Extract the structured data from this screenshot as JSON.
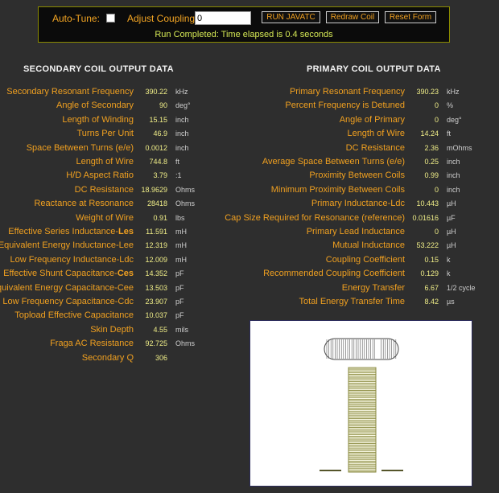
{
  "toolbar": {
    "autotune_label": "Auto-Tune:",
    "coupling_label": "Adjust Coupling:",
    "coupling_value": "0",
    "run_label": "RUN JAVATC",
    "redraw_label": "Redraw Coil",
    "reset_label": "Reset Form",
    "status": "Run Completed: Time elapsed is 0.4 seconds"
  },
  "secondary": {
    "title": "SECONDARY COIL OUTPUT DATA",
    "rows": [
      {
        "label": "Secondary Resonant Frequency",
        "value": "390.22",
        "unit": "kHz"
      },
      {
        "label": "Angle of Secondary",
        "value": "90",
        "unit": "deg°"
      },
      {
        "label": "Length of Winding",
        "value": "15.15",
        "unit": "inch"
      },
      {
        "label": "Turns Per Unit",
        "value": "46.9",
        "unit": "inch"
      },
      {
        "label": "Space Between Turns (e/e)",
        "value": "0.0012",
        "unit": "inch"
      },
      {
        "label": "Length of Wire",
        "value": "744.8",
        "unit": "ft"
      },
      {
        "label": "H/D Aspect Ratio",
        "value": "3.79",
        "unit": ":1"
      },
      {
        "label": "DC Resistance",
        "value": "18.9629",
        "unit": "Ohms"
      },
      {
        "label": "Reactance at Resonance",
        "value": "28418",
        "unit": "Ohms"
      },
      {
        "label": "Weight of Wire",
        "value": "0.91",
        "unit": "lbs"
      },
      {
        "label": "Effective Series Inductance-",
        "bold": "Les",
        "value": "11.591",
        "unit": "mH"
      },
      {
        "label": "Equivalent Energy Inductance-Lee",
        "value": "12.319",
        "unit": "mH"
      },
      {
        "label": "Low Frequency Inductance-Ldc",
        "value": "12.009",
        "unit": "mH"
      },
      {
        "label": "Effective Shunt Capacitance-",
        "bold": "Ces",
        "value": "14.352",
        "unit": "pF"
      },
      {
        "label": "Equivalent Energy Capacitance-Cee",
        "value": "13.503",
        "unit": "pF"
      },
      {
        "label": "Low Frequency Capacitance-Cdc",
        "value": "23.907",
        "unit": "pF"
      },
      {
        "label": "Topload Effective Capacitance",
        "value": "10.037",
        "unit": "pF"
      },
      {
        "label": "Skin Depth",
        "value": "4.55",
        "unit": "mils"
      },
      {
        "label": "Fraga AC Resistance",
        "value": "92.725",
        "unit": "Ohms"
      },
      {
        "label": "Secondary Q",
        "value": "306",
        "unit": ""
      }
    ]
  },
  "primary": {
    "title": "PRIMARY COIL OUTPUT DATA",
    "rows": [
      {
        "label": "Primary Resonant Frequency",
        "value": "390.23",
        "unit": "kHz"
      },
      {
        "label": "Percent Frequency is Detuned",
        "value": "0",
        "unit": "%"
      },
      {
        "label": "Angle of Primary",
        "value": "0",
        "unit": "deg°"
      },
      {
        "label": "Length of Wire",
        "value": "14.24",
        "unit": "ft"
      },
      {
        "label": "DC Resistance",
        "value": "2.36",
        "unit": "mOhms"
      },
      {
        "label": "Average Space Between Turns (e/e)",
        "value": "0.25",
        "unit": "inch"
      },
      {
        "label": "Proximity Between Coils",
        "value": "0.99",
        "unit": "inch"
      },
      {
        "label": "Minimum Proximity Between Coils",
        "value": "0",
        "unit": "inch"
      },
      {
        "label": "Primary Inductance-Ldc",
        "value": "10.443",
        "unit": "µH"
      },
      {
        "label": "Cap Size Required for Resonance (reference)",
        "value": "0.01616",
        "unit": "µF"
      },
      {
        "label": "Primary Lead Inductance",
        "value": "0",
        "unit": "µH"
      },
      {
        "label": "Mutual Inductance",
        "value": "53.222",
        "unit": "µH"
      },
      {
        "label": "Coupling Coefficient",
        "value": "0.15",
        "unit": "k"
      },
      {
        "label": "Recommended Coupling Coefficient",
        "value": "0.129",
        "unit": "k"
      },
      {
        "label": "Energy Transfer",
        "value": "6.67",
        "unit": "1/2 cycle"
      },
      {
        "label": "Total Energy Transfer Time",
        "value": "8.42",
        "unit": "µs"
      }
    ]
  },
  "colors": {
    "label": "#f0a020",
    "value": "#f0ee88",
    "status": "#d5e855",
    "coil_winding": "#8a8a40"
  }
}
